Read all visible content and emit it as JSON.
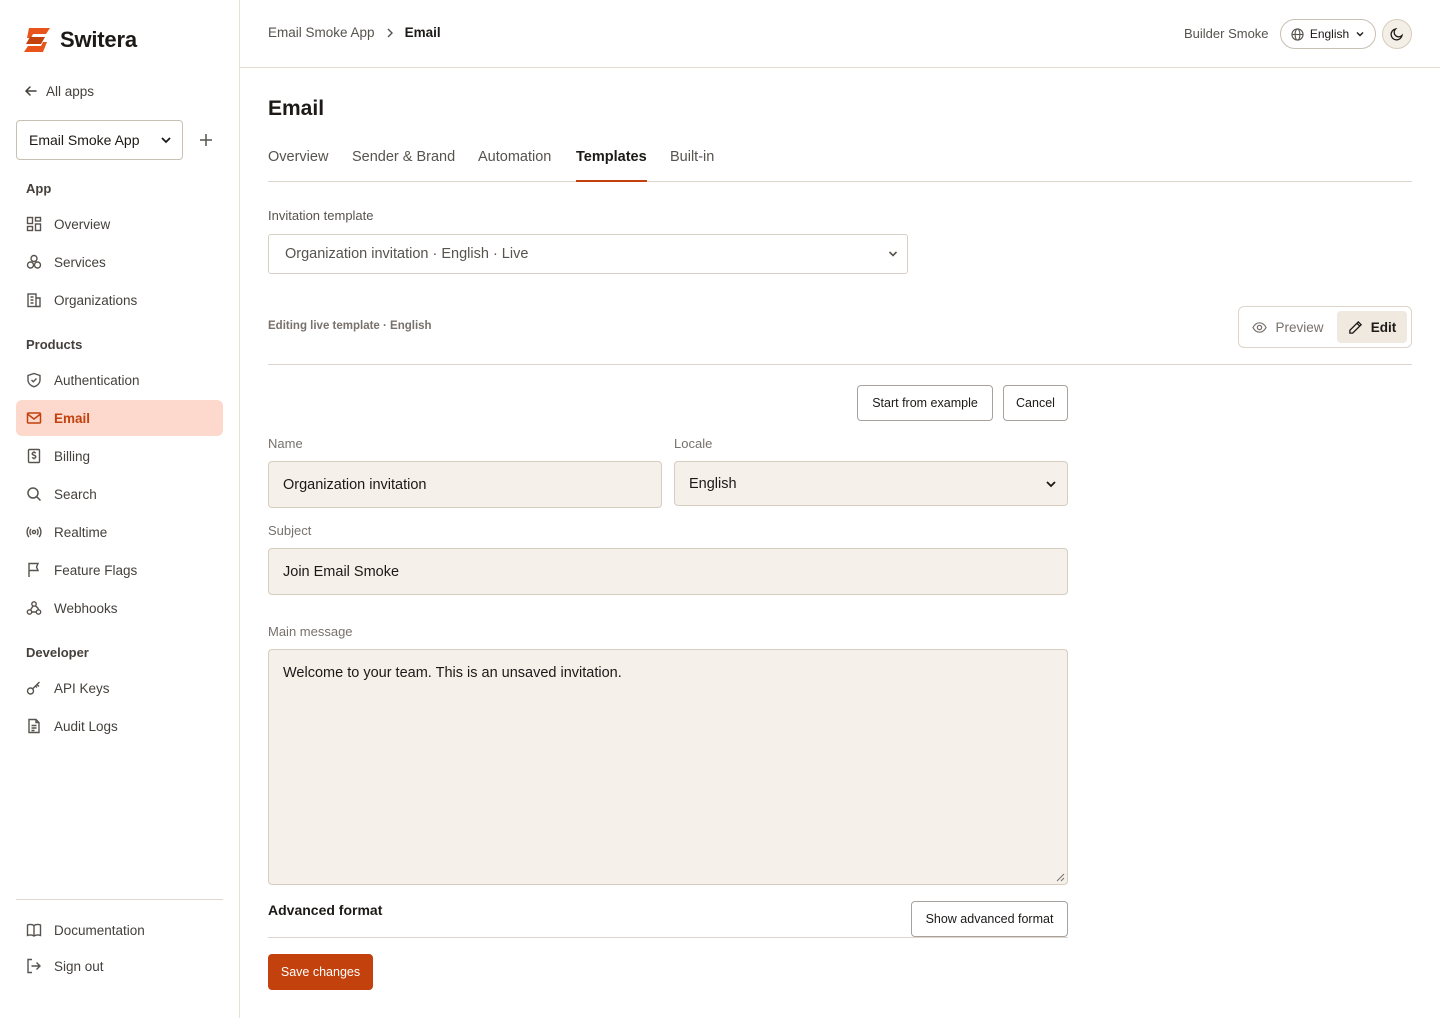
{
  "brand": {
    "name": "Switera",
    "accent": "#c2410c",
    "active_bg": "#fcd9cc"
  },
  "sidebar": {
    "all_apps": "All apps",
    "app_select": "Email Smoke App",
    "sections": {
      "app": "App",
      "products": "Products",
      "developer": "Developer"
    },
    "app_items": [
      {
        "label": "Overview",
        "icon": "dashboard-icon"
      },
      {
        "label": "Services",
        "icon": "services-icon"
      },
      {
        "label": "Organizations",
        "icon": "building-icon"
      }
    ],
    "product_items": [
      {
        "label": "Authentication",
        "icon": "shield-check-icon"
      },
      {
        "label": "Email",
        "icon": "mail-icon",
        "active": true
      },
      {
        "label": "Billing",
        "icon": "billing-icon"
      },
      {
        "label": "Search",
        "icon": "search-icon"
      },
      {
        "label": "Realtime",
        "icon": "radio-icon"
      },
      {
        "label": "Feature Flags",
        "icon": "flag-icon"
      },
      {
        "label": "Webhooks",
        "icon": "webhook-icon"
      }
    ],
    "developer_items": [
      {
        "label": "API Keys",
        "icon": "key-icon"
      },
      {
        "label": "Audit Logs",
        "icon": "file-text-icon"
      }
    ],
    "footer_items": [
      {
        "label": "Documentation",
        "icon": "book-icon"
      },
      {
        "label": "Sign out",
        "icon": "sign-out-icon"
      }
    ]
  },
  "topbar": {
    "breadcrumb": [
      "Email Smoke App",
      "Email"
    ],
    "user": "Builder Smoke",
    "language": "English"
  },
  "main": {
    "title": "Email",
    "tabs": [
      {
        "label": "Overview"
      },
      {
        "label": "Sender & Brand"
      },
      {
        "label": "Automation"
      },
      {
        "label": "Templates",
        "active": true
      },
      {
        "label": "Built-in"
      }
    ],
    "template_label": "Invitation template",
    "template_value": "Organization invitation · English · Live",
    "editing_note": "Editing live template · English",
    "view_toggle": {
      "preview": "Preview",
      "edit": "Edit",
      "selected": "Edit"
    },
    "actions": {
      "start_example": "Start from example",
      "cancel": "Cancel"
    },
    "form": {
      "name_label": "Name",
      "name_value": "Organization invitation",
      "locale_label": "Locale",
      "locale_value": "English",
      "subject_label": "Subject",
      "subject_value": "Join Email Smoke",
      "message_label": "Main message",
      "message_value": "Welcome to your team. This is an unsaved invitation."
    },
    "advanced": {
      "title": "Advanced format",
      "button": "Show advanced format"
    },
    "save": "Save changes"
  }
}
